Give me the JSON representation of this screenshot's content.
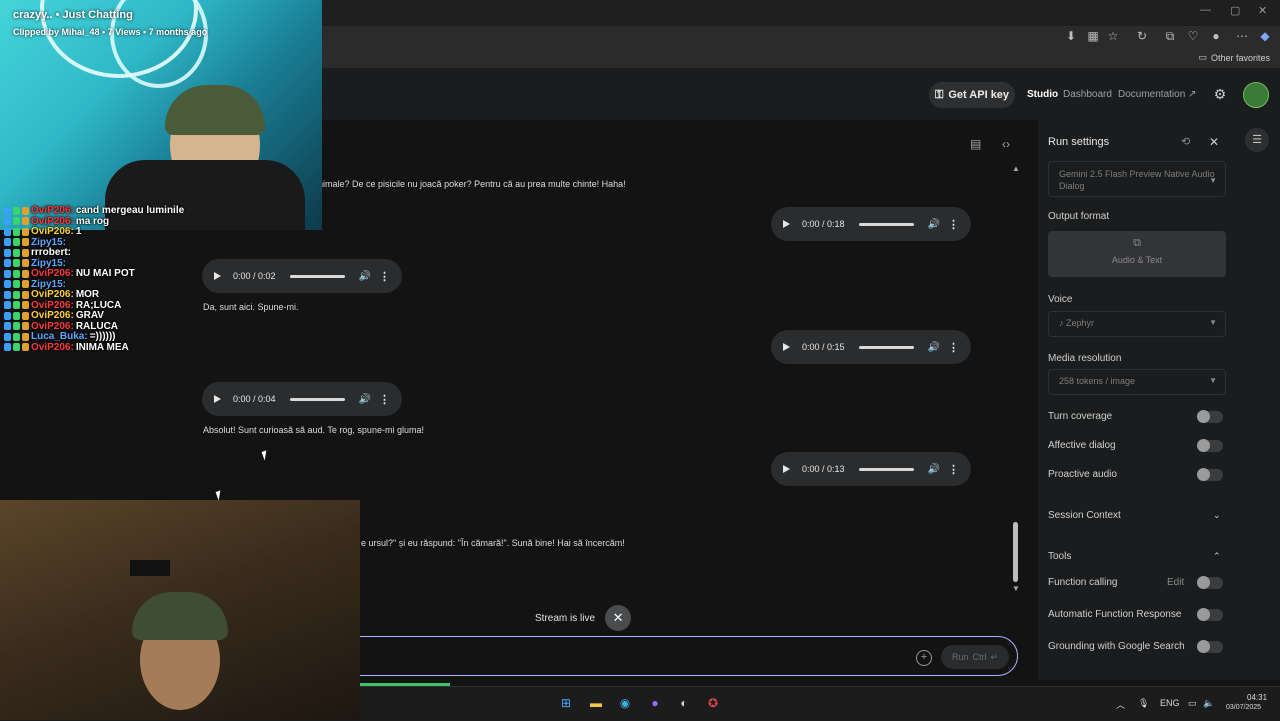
{
  "browser": {
    "favorites_label": "Other favorites"
  },
  "header": {
    "api_key_label": "Get API key",
    "nav": [
      "Studio",
      "Dashboard",
      "Documentation"
    ]
  },
  "chat": {
    "partial_top": "nimale? De ce pisicile nu joacă poker? Pentru că au prea multe chinte! Haha!",
    "audio_right_1": "0:00 / 0:18",
    "audio_left_1": "0:00 / 0:02",
    "msg_1": "Da, sunt aici. Spune-mi.",
    "audio_right_2": "0:00 / 0:15",
    "audio_left_2": "0:00 / 0:04",
    "msg_2": "Absolut! Sunt curioasă să aud. Te rog, spune-mi gluma!",
    "audio_right_3": "0:00 / 0:13",
    "partial_bottom": "e ursul?\" și eu răspund: \"În cămară!\". Sună bine! Hai să încercăm!",
    "stream_status": "Stream is live",
    "run_label": "Run",
    "run_shortcut": "Ctrl"
  },
  "settings": {
    "title": "Run settings",
    "model": "Gemini 2.5 Flash Preview Native Audio Dialog",
    "output_format_label": "Output format",
    "output_format_value": "Audio & Text",
    "voice_label": "Voice",
    "voice_value": "Zephyr",
    "media_label": "Media resolution",
    "media_value": "258 tokens / image",
    "turn_coverage": "Turn coverage",
    "affective_dialog": "Affective dialog",
    "proactive_audio": "Proactive audio",
    "session_context": "Session Context",
    "tools": "Tools",
    "function_calling": "Function calling",
    "edit_label": "Edit",
    "auto_function": "Automatic Function Response",
    "grounding": "Grounding with Google Search"
  },
  "taskbar": {
    "lang": "ENG",
    "time": "04:31",
    "date": "03/07/2025"
  },
  "stream_overlay": {
    "clip_title": "crazyy.. • Just Chatting",
    "clip_sub": "Clipped by Mihai_48 • 7 Views • 7 months ago",
    "chat": [
      {
        "user": "OviP206:",
        "msg": "cand mergeau luminile",
        "color": "un-red"
      },
      {
        "user": "OviP206:",
        "msg": "ma rog",
        "color": "un-red"
      },
      {
        "user": "OviP206:",
        "msg": "1",
        "color": "un-yellow"
      },
      {
        "user": "Zipy15:",
        "msg": "",
        "color": "un-blue"
      },
      {
        "user": "rrrobert:",
        "msg": "",
        "color": "un-white"
      },
      {
        "user": "Zipy15:",
        "msg": "",
        "color": "un-blue"
      },
      {
        "user": "OviP206:",
        "msg": "NU MAI POT",
        "color": "un-red"
      },
      {
        "user": "Zipy15:",
        "msg": "",
        "color": "un-blue"
      },
      {
        "user": "OviP206:",
        "msg": "MOR",
        "color": "un-yellow"
      },
      {
        "user": "OviP206:",
        "msg": "RA;LUCA",
        "color": "un-red"
      },
      {
        "user": "OviP206:",
        "msg": "GRAV",
        "color": "un-yellow"
      },
      {
        "user": "OviP206:",
        "msg": "RALUCA",
        "color": "un-red"
      },
      {
        "user": "Luca_Buka:",
        "msg": "=))))))",
        "color": "un-blue"
      },
      {
        "user": "OviP206:",
        "msg": "INIMA MEA",
        "color": "un-red"
      }
    ]
  }
}
